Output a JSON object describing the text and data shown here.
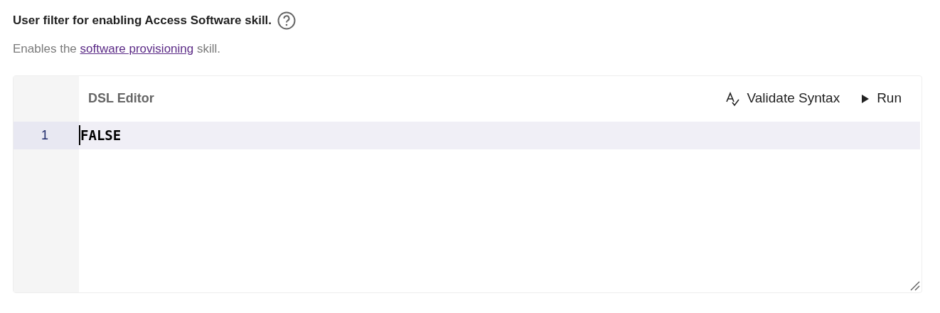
{
  "heading": "User filter for enabling Access Software skill.",
  "description": {
    "before": "Enables the",
    "link": "software provisioning",
    "after": "skill."
  },
  "editor": {
    "title": "DSL Editor",
    "actions": [
      {
        "label": "Validate Syntax",
        "kind": "validate"
      },
      {
        "label": "Run",
        "kind": "run"
      }
    ],
    "lines": [
      {
        "number": "1",
        "text": "FALSE",
        "active": true
      }
    ]
  }
}
